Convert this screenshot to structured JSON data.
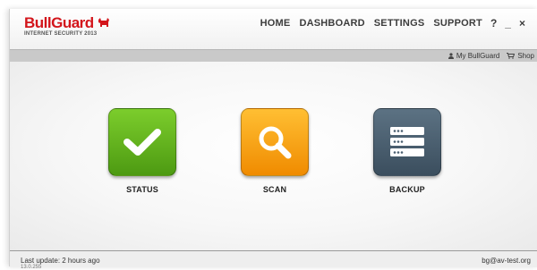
{
  "logo": {
    "brand": "BullGuard",
    "product": "INTERNET SECURITY 2013",
    "brand_color": "#d3151b"
  },
  "nav": {
    "items": [
      "HOME",
      "DASHBOARD",
      "SETTINGS",
      "SUPPORT"
    ],
    "help": "?",
    "minimize": "_",
    "close": "×"
  },
  "subbar": {
    "account_label": "My BullGuard",
    "account_icon": "user-icon",
    "shop_label": "Shop",
    "shop_icon": "cart-icon"
  },
  "tiles": [
    {
      "label": "STATUS",
      "icon": "checkmark-icon",
      "color": "#5fb11a"
    },
    {
      "label": "SCAN",
      "icon": "magnifier-icon",
      "color": "#f9a514"
    },
    {
      "label": "BACKUP",
      "icon": "backup-icon",
      "color": "#4a5f70"
    }
  ],
  "footer": {
    "last_update": "Last update: 2 hours ago",
    "version": "13.0.255",
    "email": "bg@av-test.org"
  }
}
